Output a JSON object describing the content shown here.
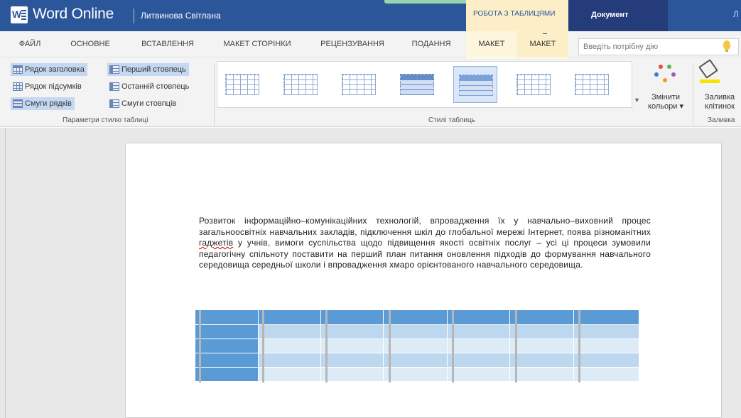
{
  "titlebar": {
    "app_name": "Word Online",
    "user": "Литвинова Світлана",
    "context_group": "РОБОТА З ТАБЛИЦЯМИ",
    "document_label": "Документ",
    "right_text": "Л",
    "brand_color": "#2b579a"
  },
  "tabs": [
    {
      "label": "ФАЙЛ"
    },
    {
      "label": "ОСНОВНЕ"
    },
    {
      "label": "ВСТАВЛЕННЯ"
    },
    {
      "label": "МАКЕТ СТОРІНКИ"
    },
    {
      "label": "РЕЦЕНЗУВАННЯ"
    },
    {
      "label": "ПОДАННЯ"
    },
    {
      "label": "МАКЕТ"
    },
    {
      "label": "МАКЕТ"
    }
  ],
  "search": {
    "placeholder": "Введіть потрібну дію",
    "icon": "lightbulb-icon"
  },
  "ribbon": {
    "table_options": {
      "header_row": "Рядок заголовка",
      "total_row": "Рядок підсумків",
      "banded_rows": "Смуги рядків",
      "first_column": "Перший стовпець",
      "last_column": "Останній стовпець",
      "banded_columns": "Смуги стовпців",
      "group_label": "Параметри стилю таблиці"
    },
    "table_styles": {
      "group_label": "Стилі таблиць",
      "more_icon": "chevron-down-icon"
    },
    "change_colors": {
      "line1": "Змінити",
      "line2": "кольори",
      "caret": "▾"
    },
    "shading": {
      "line1": "Заливка",
      "line2": "клітинок",
      "group_label": "Заливка"
    }
  },
  "document": {
    "paragraph_before": "Розвиток інформаційно–комунікаційних технологій, впровадження їх у навчально–виховний процес загальноосвітніх навчальних закладів, підключення шкіл до глобальної мережі Інтернет, поява різноманітних ",
    "misspelled_word": "гаджетів",
    "paragraph_after": " у учнів, вимоги суспільства щодо підвищення якості освітніх послуг – усі ці процеси зумовили педагогічну спільноту поставити на перший план питання оновлення підходів до формування навчального середовища середньої школи і впровадження хмаро орієнтованого навчального середовища.",
    "table_style_colors": {
      "header": "#5b9bd5",
      "band1": "#bdd7ee",
      "band2": "#ddebf7"
    }
  }
}
